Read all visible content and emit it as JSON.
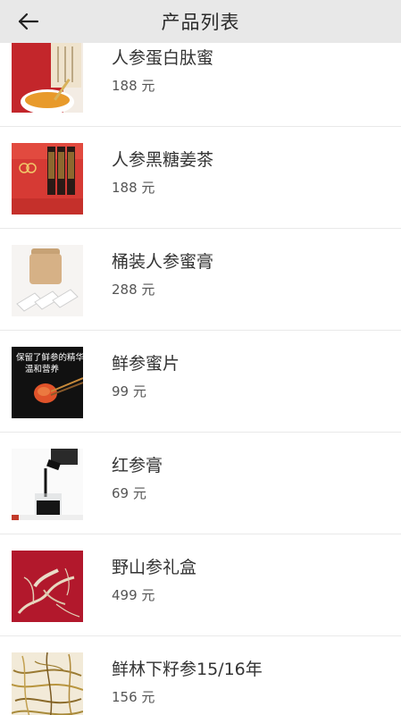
{
  "header": {
    "title": "产品列表",
    "back_icon": "arrow-left-icon"
  },
  "products": [
    {
      "name": "人参蛋白肽蜜",
      "price": "188 元"
    },
    {
      "name": "人参黑糖姜茶",
      "price": "188 元"
    },
    {
      "name": "桶装人参蜜膏",
      "price": "288 元"
    },
    {
      "name": "鲜参蜜片",
      "price": "99 元",
      "image_text": [
        "保留了鲜参的精华",
        "温和营养"
      ]
    },
    {
      "name": "红参膏",
      "price": "69 元"
    },
    {
      "name": "野山参礼盒",
      "price": "499 元"
    },
    {
      "name": "鲜林下籽参15/16年",
      "price": "156 元"
    }
  ]
}
